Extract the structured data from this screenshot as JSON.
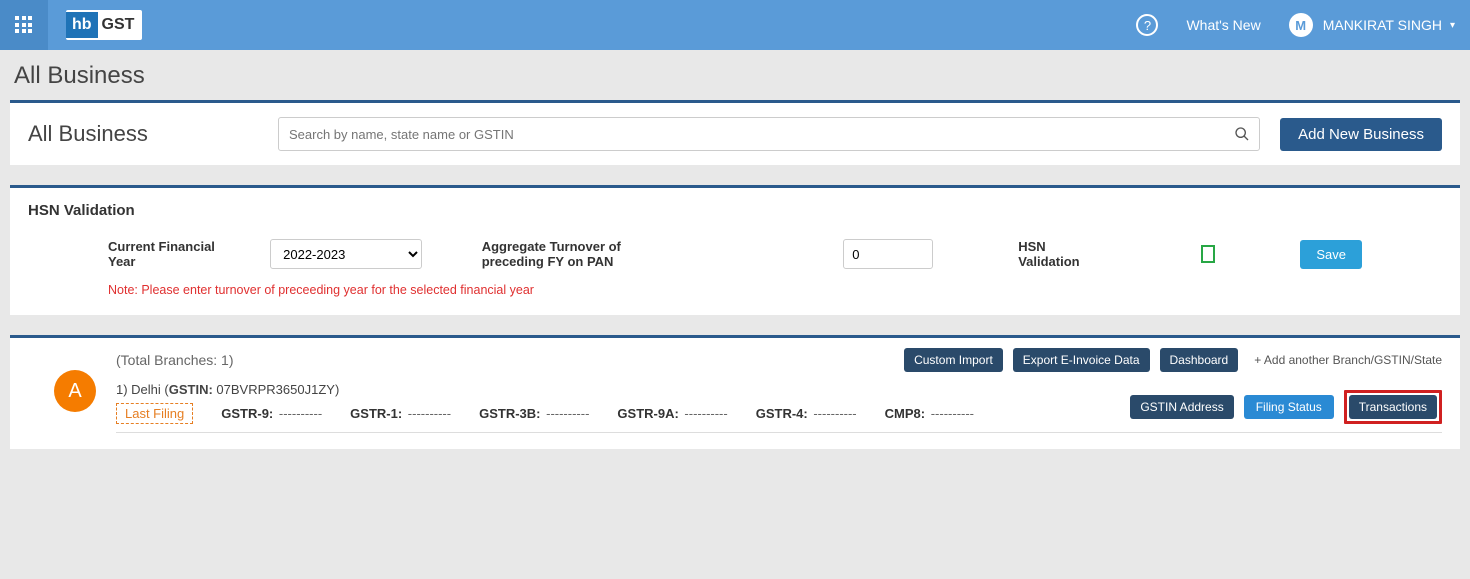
{
  "topbar": {
    "logo_hb": "hb",
    "logo_gst": "GST",
    "help_char": "?",
    "whats_new": "What's New",
    "user_initial": "M",
    "user_name": "MANKIRAT SINGH"
  },
  "page_title": "All Business",
  "search_card": {
    "title": "All Business",
    "search_placeholder": "Search by name, state name or GSTIN",
    "add_button": "Add New Business"
  },
  "hsn": {
    "title": "HSN Validation",
    "fy_label": "Current Financial Year",
    "fy_value": "2022-2023",
    "turnover_label": "Aggregate Turnover of preceding FY on PAN",
    "turnover_value": "0",
    "hsnv_label": "HSN Validation",
    "save_label": "Save",
    "note": "Note: Please enter turnover of preceeding year for the selected financial year"
  },
  "business": {
    "branches_text": "(Total Branches: 1)",
    "custom_import": "Custom Import",
    "export_einvoice": "Export E-Invoice Data",
    "dashboard": "Dashboard",
    "add_branch_link": "+ Add another Branch/GSTIN/State",
    "avatar_letter": "A",
    "branch_prefix": "1) Delhi (",
    "gstin_label": "GSTIN: ",
    "gstin_value": "07BVRPR3650J1ZY",
    "branch_suffix": ")",
    "last_filing": "Last Filing",
    "gstr9_k": "GSTR-9:",
    "gstr9_v": "----------",
    "gstr1_k": "GSTR-1:",
    "gstr1_v": "----------",
    "gstr3b_k": "GSTR-3B:",
    "gstr3b_v": "----------",
    "gstr9a_k": "GSTR-9A:",
    "gstr9a_v": "----------",
    "gstr4_k": "GSTR-4:",
    "gstr4_v": "----------",
    "cmp8_k": "CMP8:",
    "cmp8_v": "----------",
    "gstin_address": "GSTIN Address",
    "filing_status": "Filing Status",
    "transactions": "Transactions"
  }
}
